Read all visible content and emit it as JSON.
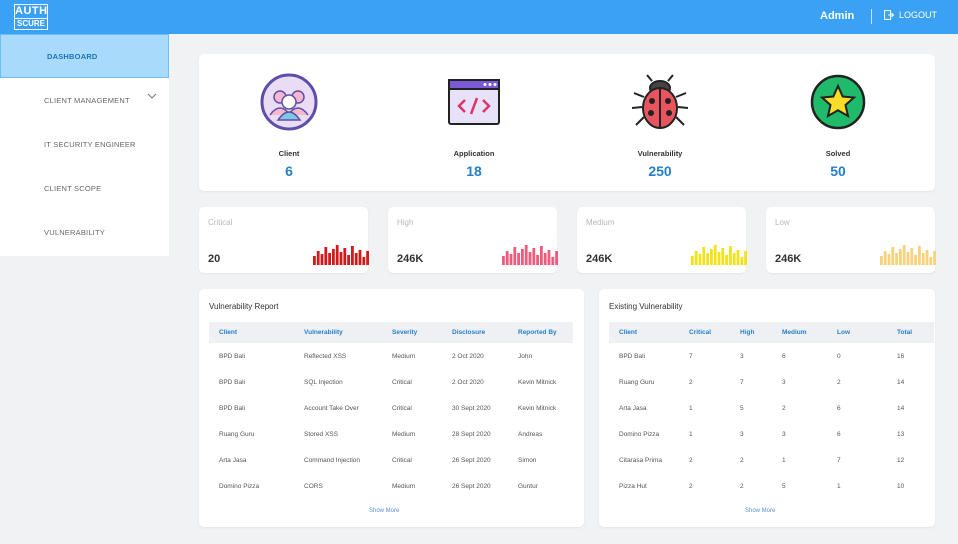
{
  "header": {
    "logo_line1": "AUTH",
    "logo_line2": "SCURE",
    "user": "Admin",
    "logout": "LOGOUT"
  },
  "sidebar": {
    "items": [
      {
        "label": "DASHBOARD"
      },
      {
        "label": "CLIENT MANAGEMENT"
      },
      {
        "label": "IT SECURITY ENGINEER"
      },
      {
        "label": "CLIENT SCOPE"
      },
      {
        "label": "VULNERABILITY"
      }
    ]
  },
  "stats": [
    {
      "label": "Client",
      "value": "6",
      "icon": "client-group-icon"
    },
    {
      "label": "Application",
      "value": "18",
      "icon": "code-window-icon"
    },
    {
      "label": "Vulnerability",
      "value": "250",
      "icon": "bug-icon"
    },
    {
      "label": "Solved",
      "value": "50",
      "icon": "star-icon"
    }
  ],
  "severity_cards": [
    {
      "title": "Critical",
      "value": "20",
      "color": "#d31a1a"
    },
    {
      "title": "High",
      "value": "246K",
      "color": "#ef5b7d"
    },
    {
      "title": "Medium",
      "value": "246K",
      "color": "#f2e21b"
    },
    {
      "title": "Low",
      "value": "246K",
      "color": "#f7d27c"
    }
  ],
  "vulnerability_report": {
    "title": "Vulnerability Report",
    "headers": [
      "Client",
      "Vulnerability",
      "Severity",
      "Disclosure",
      "Reported By"
    ],
    "rows": [
      [
        "BPD Bali",
        "Reflected XSS",
        "Medium",
        "2 Oct 2020",
        "John"
      ],
      [
        "BPD Bali",
        "SQL Injection",
        "Critical",
        "2 Oct 2020",
        "Kevin Mitnick"
      ],
      [
        "BPD Bali",
        "Account Take Over",
        "Critical",
        "30 Sept 2020",
        "Kevin Mitnick"
      ],
      [
        "Ruang Guru",
        "Stored XSS",
        "Medium",
        "28 Sept 2020",
        "Andreas"
      ],
      [
        "Arta Jasa",
        "Command Injection",
        "Critical",
        "26 Sept 2020",
        "Simon"
      ],
      [
        "Domino Pizza",
        "CORS",
        "Medium",
        "26 Sept 2020",
        "Guntur"
      ]
    ],
    "show_more": "Show More"
  },
  "existing_vulnerability": {
    "title": "Existing Vulnerability",
    "headers": [
      "Client",
      "Critical",
      "High",
      "Medium",
      "Low",
      "Total"
    ],
    "rows": [
      [
        "BPD Bali",
        "7",
        "3",
        "6",
        "0",
        "16"
      ],
      [
        "Ruang Guru",
        "2",
        "7",
        "3",
        "2",
        "14"
      ],
      [
        "Arta Jasa",
        "1",
        "5",
        "2",
        "6",
        "14"
      ],
      [
        "Domino Pizza",
        "1",
        "3",
        "3",
        "6",
        "13"
      ],
      [
        "Citarasa Prima",
        "2",
        "2",
        "1",
        "7",
        "12"
      ],
      [
        "Pizza Hut",
        "2",
        "2",
        "5",
        "1",
        "10"
      ]
    ],
    "show_more": "Show More"
  }
}
